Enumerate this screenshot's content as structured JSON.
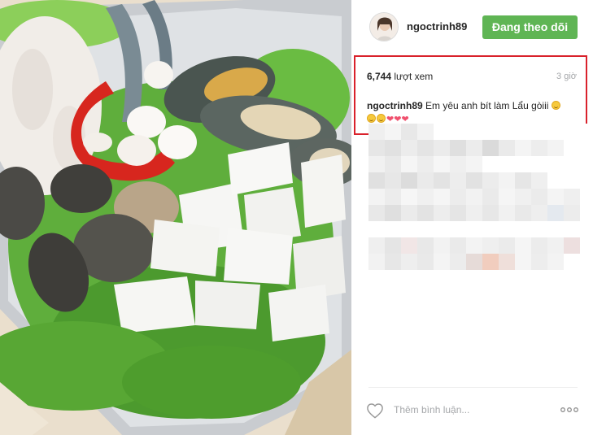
{
  "post": {
    "username": "ngoctrinh89",
    "follow_label": "Đang theo dõi",
    "views_count": "6,744",
    "views_unit": "lượt xem",
    "time_ago": "3 giờ",
    "caption_user": "ngoctrinh89",
    "caption_text": "Em yêu anh bít làm Lẩu gòiii"
  },
  "comment": {
    "placeholder": "Thêm bình luận..."
  },
  "icons": {
    "like": "heart-outline-icon",
    "more": "more-options-icon",
    "emoji": "smiling-face-emoji",
    "heart_emoji": "red-heart-emoji"
  },
  "colors": {
    "follow_button": "#5fb554",
    "highlight_border": "#d9212b",
    "muted_text": "#a5a7aa"
  }
}
